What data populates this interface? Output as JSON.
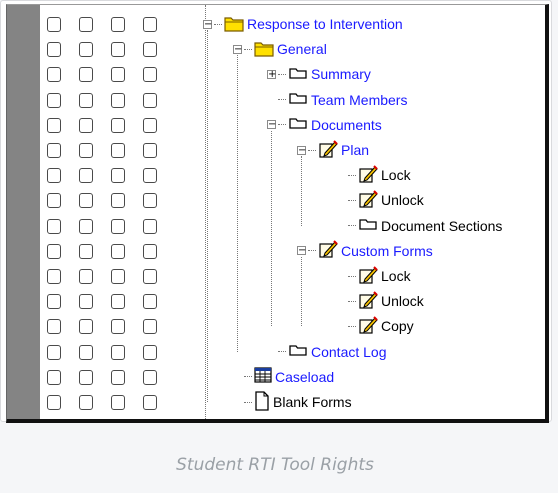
{
  "tree": {
    "items": [
      {
        "label": "Response to Intervention",
        "icon": "folder-open-icon",
        "toggle": "−",
        "link": true
      },
      {
        "label": "General",
        "icon": "folder-open-icon",
        "toggle": "−",
        "link": true
      },
      {
        "label": "Summary",
        "icon": "tab-icon",
        "toggle": "+",
        "link": true
      },
      {
        "label": "Team Members",
        "icon": "tab-icon",
        "toggle": "",
        "link": true
      },
      {
        "label": "Documents",
        "icon": "tab-icon",
        "toggle": "−",
        "link": true
      },
      {
        "label": "Plan",
        "icon": "edit-doc-icon",
        "toggle": "−",
        "link": true
      },
      {
        "label": "Lock",
        "icon": "edit-doc-icon",
        "toggle": "",
        "link": false
      },
      {
        "label": "Unlock",
        "icon": "edit-doc-icon",
        "toggle": "",
        "link": false
      },
      {
        "label": "Document Sections",
        "icon": "tab-icon",
        "toggle": "",
        "link": false
      },
      {
        "label": "Custom Forms",
        "icon": "edit-doc-icon",
        "toggle": "−",
        "link": true
      },
      {
        "label": "Lock",
        "icon": "edit-doc-icon",
        "toggle": "",
        "link": false
      },
      {
        "label": "Unlock",
        "icon": "edit-doc-icon",
        "toggle": "",
        "link": false
      },
      {
        "label": "Copy",
        "icon": "edit-doc-icon",
        "toggle": "",
        "link": false
      },
      {
        "label": "Contact Log",
        "icon": "tab-icon",
        "toggle": "",
        "link": true
      },
      {
        "label": "Caseload",
        "icon": "grid-icon",
        "toggle": "",
        "link": true
      },
      {
        "label": "Blank Forms",
        "icon": "page-icon",
        "toggle": "",
        "link": false
      }
    ]
  },
  "caption": "Student RTI Tool Rights",
  "colors": {
    "link": "#1a1aff",
    "folder": "#ffe000",
    "gutter": "#848484"
  }
}
